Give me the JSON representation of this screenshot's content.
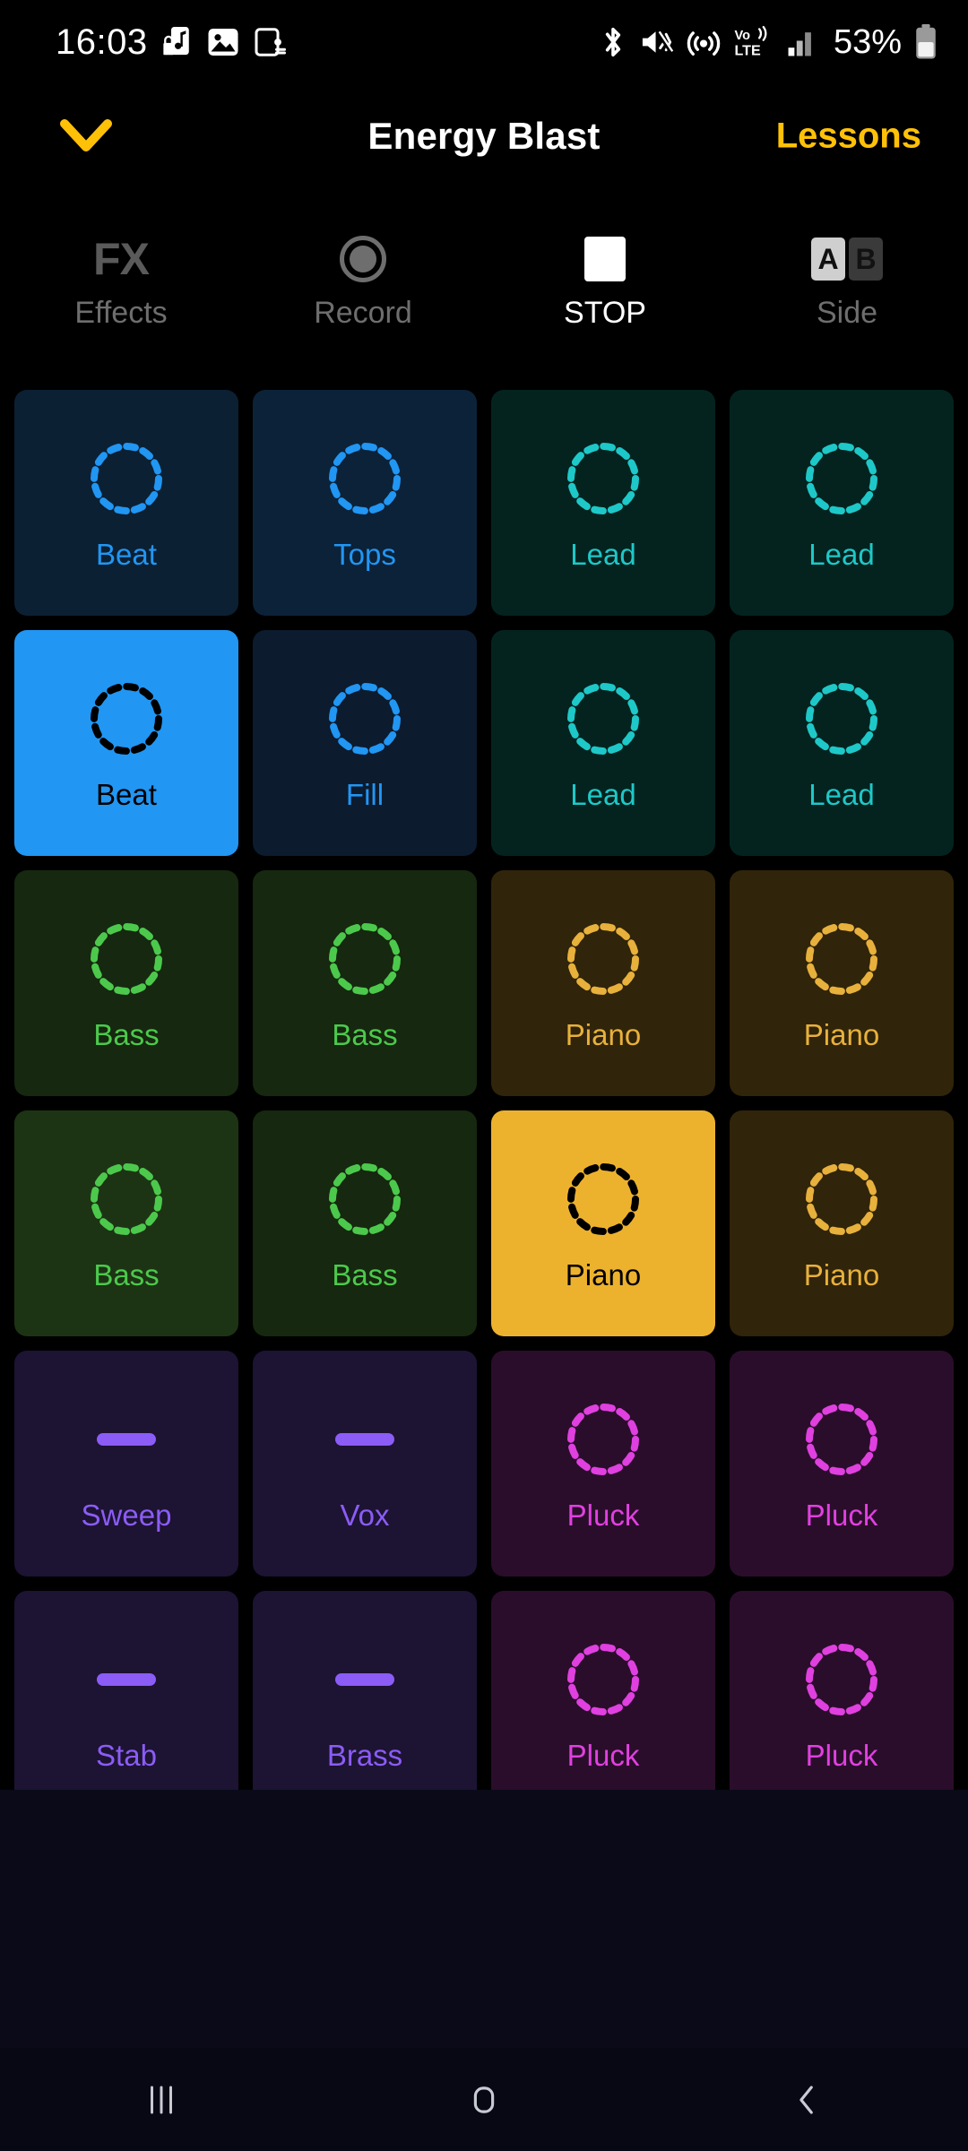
{
  "statusbar": {
    "time": "16:03",
    "left_icons": [
      "music-note-lock-icon",
      "image-icon",
      "device-connect-icon"
    ],
    "right_icons": [
      "bluetooth-icon",
      "mute-vibrate-icon",
      "hotspot-icon",
      "volte-icon",
      "signal-bars-icon"
    ],
    "battery_percent": "53%"
  },
  "header": {
    "collapse_label": "chevron-down",
    "title": "Energy Blast",
    "lessons_label": "Lessons",
    "accent_color": "#FFC107"
  },
  "toolbar": {
    "items": [
      {
        "icon": "fx-icon",
        "glyph": "FX",
        "label": "Effects",
        "active": false
      },
      {
        "icon": "record-icon",
        "glyph": "",
        "label": "Record",
        "active": false
      },
      {
        "icon": "stop-icon",
        "glyph": "",
        "label": "STOP",
        "active": true
      },
      {
        "icon": "ab-toggle-icon",
        "glyph": "",
        "label": "Side",
        "active": false
      }
    ],
    "ab_toggle": {
      "a_label": "A",
      "b_label": "B",
      "selected": "A"
    }
  },
  "grid": {
    "columns": 4,
    "rows": 6,
    "pads": [
      {
        "label": "Beat",
        "icon": "dashed-circle-icon",
        "bg": "#0c2033",
        "fg": "#2196F3",
        "active": false
      },
      {
        "label": "Tops",
        "icon": "dashed-circle-icon",
        "bg": "#0c2238",
        "fg": "#2196F3",
        "active": false
      },
      {
        "label": "Lead",
        "icon": "dashed-circle-icon",
        "bg": "#04231f",
        "fg": "#1ec8c8",
        "active": false
      },
      {
        "label": "Lead",
        "icon": "dashed-circle-icon",
        "bg": "#04231f",
        "fg": "#1ec8c8",
        "active": false
      },
      {
        "label": "Beat",
        "icon": "dashed-circle-icon",
        "bg": "#2196F3",
        "fg": "#000000",
        "active": true
      },
      {
        "label": "Fill",
        "icon": "dashed-circle-icon",
        "bg": "#0c1b2e",
        "fg": "#2196F3",
        "active": false
      },
      {
        "label": "Lead",
        "icon": "dashed-circle-icon",
        "bg": "#04231f",
        "fg": "#1ec8c8",
        "active": false
      },
      {
        "label": "Lead",
        "icon": "dashed-circle-icon",
        "bg": "#04231f",
        "fg": "#1ec8c8",
        "active": false
      },
      {
        "label": "Bass",
        "icon": "dashed-circle-icon",
        "bg": "#16280f",
        "fg": "#4CC94C",
        "active": false
      },
      {
        "label": "Bass",
        "icon": "dashed-circle-icon",
        "bg": "#16280f",
        "fg": "#4CC94C",
        "active": false
      },
      {
        "label": "Piano",
        "icon": "dashed-circle-icon",
        "bg": "#30240a",
        "fg": "#E8B13C",
        "active": false
      },
      {
        "label": "Piano",
        "icon": "dashed-circle-icon",
        "bg": "#30240a",
        "fg": "#E8B13C",
        "active": false
      },
      {
        "label": "Bass",
        "icon": "dashed-circle-icon",
        "bg": "#1d3414",
        "fg": "#4CC94C",
        "active": false
      },
      {
        "label": "Bass",
        "icon": "dashed-circle-icon",
        "bg": "#16280f",
        "fg": "#4CC94C",
        "active": false
      },
      {
        "label": "Piano",
        "icon": "dashed-circle-icon",
        "bg": "#EDB22D",
        "fg": "#000000",
        "active": true
      },
      {
        "label": "Piano",
        "icon": "dashed-circle-icon",
        "bg": "#30240a",
        "fg": "#E8B13C",
        "active": false
      },
      {
        "label": "Sweep",
        "icon": "bar-icon",
        "bg": "#1d1333",
        "fg": "#8B5CF6",
        "active": false
      },
      {
        "label": "Vox",
        "icon": "bar-icon",
        "bg": "#1d1333",
        "fg": "#8B5CF6",
        "active": false
      },
      {
        "label": "Pluck",
        "icon": "dashed-circle-icon",
        "bg": "#2a0d2b",
        "fg": "#E040E0",
        "active": false
      },
      {
        "label": "Pluck",
        "icon": "dashed-circle-icon",
        "bg": "#2a0d2b",
        "fg": "#E040E0",
        "active": false
      },
      {
        "label": "Stab",
        "icon": "bar-icon",
        "bg": "#1d1333",
        "fg": "#8B5CF6",
        "active": false
      },
      {
        "label": "Brass",
        "icon": "bar-icon",
        "bg": "#1d1333",
        "fg": "#8B5CF6",
        "active": false
      },
      {
        "label": "Pluck",
        "icon": "dashed-circle-icon",
        "bg": "#2a0d2b",
        "fg": "#E040E0",
        "active": false
      },
      {
        "label": "Pluck",
        "icon": "dashed-circle-icon",
        "bg": "#2a0d2b",
        "fg": "#E040E0",
        "active": false
      }
    ]
  },
  "navbar": {
    "buttons": [
      {
        "icon": "recents-icon",
        "label": "Recents"
      },
      {
        "icon": "home-icon",
        "label": "Home"
      },
      {
        "icon": "back-icon",
        "label": "Back"
      }
    ]
  }
}
